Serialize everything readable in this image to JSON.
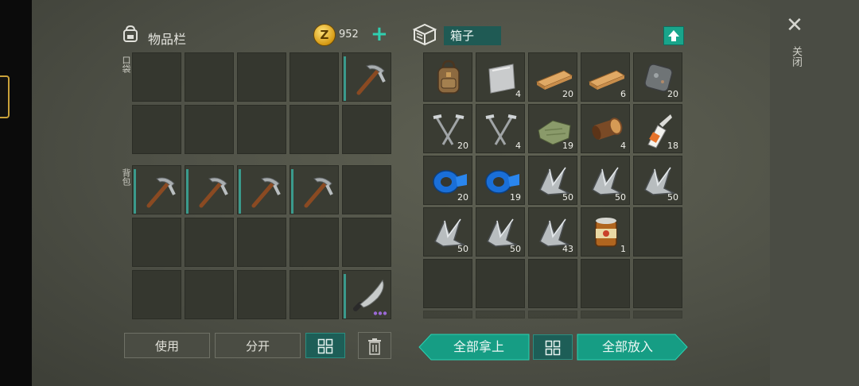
{
  "inventory": {
    "title": "物品栏",
    "coins": "952",
    "pocket_label": "口袋",
    "backpack_label": "背包",
    "pocket_items": [
      {
        "slot": 4,
        "icon": "pickaxe-icon",
        "qty": ""
      }
    ],
    "backpack_items": [
      {
        "slot": 0,
        "icon": "pickaxe-icon",
        "qty": ""
      },
      {
        "slot": 1,
        "icon": "pickaxe-icon",
        "qty": ""
      },
      {
        "slot": 2,
        "icon": "pickaxe-icon",
        "qty": ""
      },
      {
        "slot": 3,
        "icon": "pickaxe-icon",
        "qty": ""
      },
      {
        "slot": 14,
        "icon": "machete-icon",
        "qty": ""
      }
    ],
    "buttons": {
      "use": "使用",
      "split": "分开"
    }
  },
  "container": {
    "name": "箱子",
    "items": [
      {
        "icon": "backpack-icon",
        "qty": ""
      },
      {
        "icon": "metal-plate-icon",
        "qty": "4"
      },
      {
        "icon": "plank-icon",
        "qty": "20"
      },
      {
        "icon": "plank-icon",
        "qty": "6"
      },
      {
        "icon": "iron-ore-icon",
        "qty": "20"
      },
      {
        "icon": "nails-icon",
        "qty": "20"
      },
      {
        "icon": "nails-icon",
        "qty": "4"
      },
      {
        "icon": "cloth-icon",
        "qty": "19"
      },
      {
        "icon": "log-icon",
        "qty": "4"
      },
      {
        "icon": "glue-icon",
        "qty": "18"
      },
      {
        "icon": "duct-tape-icon",
        "qty": "20"
      },
      {
        "icon": "duct-tape-icon",
        "qty": "19"
      },
      {
        "icon": "scrap-metal-icon",
        "qty": "50"
      },
      {
        "icon": "scrap-metal-icon",
        "qty": "50"
      },
      {
        "icon": "scrap-metal-icon",
        "qty": "50"
      },
      {
        "icon": "scrap-metal-icon",
        "qty": "50"
      },
      {
        "icon": "scrap-metal-icon",
        "qty": "50"
      },
      {
        "icon": "scrap-metal-icon",
        "qty": "43"
      },
      {
        "icon": "canned-food-icon",
        "qty": "1"
      }
    ],
    "buttons": {
      "take_all": "全部拿上",
      "put_all": "全部放入"
    }
  },
  "close_label": "关闭"
}
